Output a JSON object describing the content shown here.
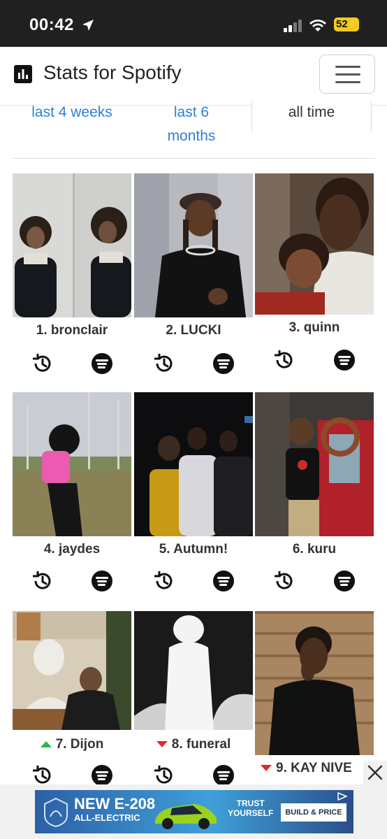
{
  "status_bar": {
    "time": "00:42",
    "battery": "52"
  },
  "app": {
    "title": "Stats for Spotify"
  },
  "tabs": [
    {
      "line1": "last 4 weeks",
      "line2": ""
    },
    {
      "line1": "last 6",
      "line2": "months"
    },
    {
      "line1": "all time",
      "line2": ""
    }
  ],
  "artists": [
    {
      "rank_label": "1. bronclair",
      "trend": "none"
    },
    {
      "rank_label": "2. LUCKI",
      "trend": "none"
    },
    {
      "rank_label": "3. quinn",
      "trend": "none"
    },
    {
      "rank_label": "4. jaydes",
      "trend": "none"
    },
    {
      "rank_label": "5. Autumn!",
      "trend": "none"
    },
    {
      "rank_label": "6. kuru",
      "trend": "none"
    },
    {
      "rank_label": "7. Dijon",
      "trend": "up"
    },
    {
      "rank_label": "8. funeral",
      "trend": "down"
    },
    {
      "rank_label": "9. KAY NIVE",
      "trend": "down"
    }
  ],
  "ad": {
    "headline": "NEW E-208",
    "subline": "ALL-ELECTRIC",
    "trust_line1": "TRUST",
    "trust_line2": "YOURSELF",
    "cta": "BUILD & PRICE"
  },
  "colors": {
    "link": "#2e7fd8",
    "trend_up": "#2db84b",
    "trend_down": "#e02a2a"
  }
}
